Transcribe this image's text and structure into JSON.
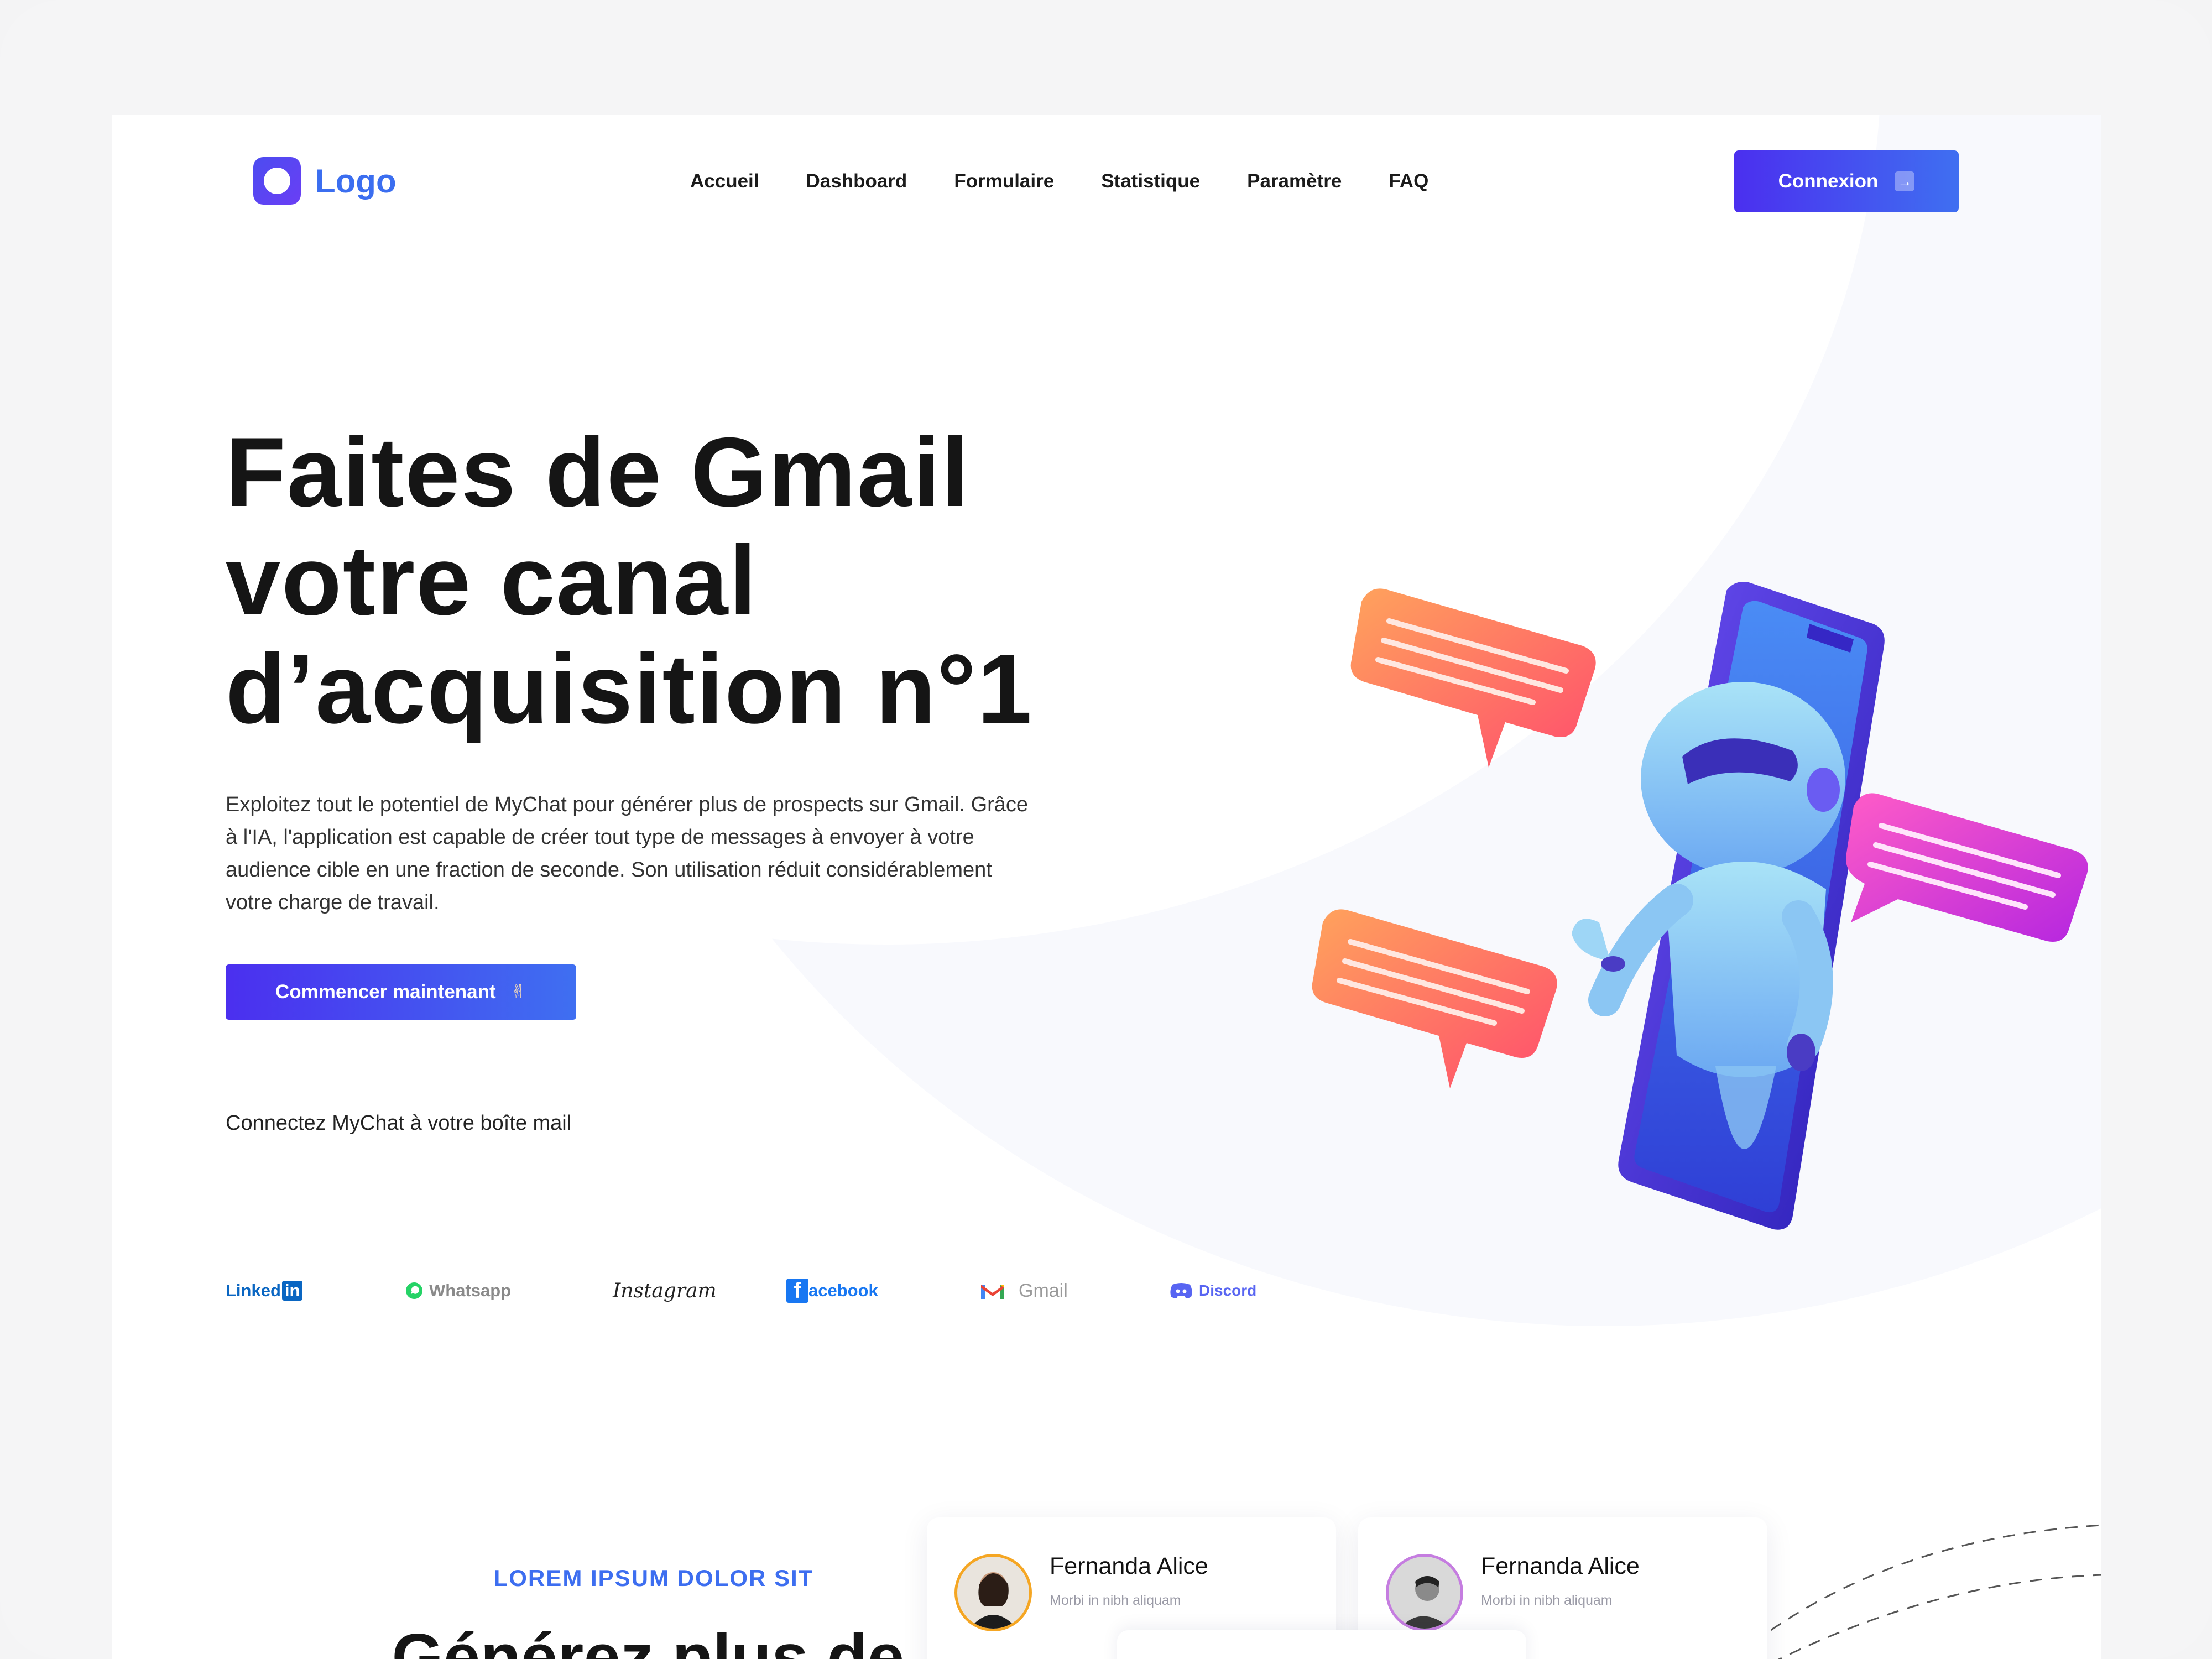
{
  "logo": {
    "text": "Logo"
  },
  "nav": {
    "items": [
      "Accueil",
      "Dashboard",
      "Formulaire",
      "Statistique",
      "Paramètre",
      "FAQ"
    ]
  },
  "login_button": {
    "label": "Connexion",
    "icon": "login-arrow-icon"
  },
  "hero": {
    "title_lines": [
      "Faites de Gmail",
      "votre canal",
      "d’acquisition n°1"
    ],
    "description": "Exploitez tout le potentiel de MyChat pour générer plus de prospects sur Gmail. Grâce à l'IA, l'application est capable de créer tout type de messages à envoyer à votre audience cible en une fraction de seconde. Son utilisation réduit considérablement votre charge de travail.",
    "cta_label": "Commencer maintenant",
    "cta_emoji": "✌",
    "connect_label": "Connectez MyChat à votre boîte mail"
  },
  "brands": [
    "Linked",
    "in",
    "Whatsapp",
    "Instagram",
    "acebook",
    "Gmail",
    "Discord"
  ],
  "section2": {
    "eyebrow": "LOREM IPSUM DOLOR SIT",
    "title": "Générez plus de"
  },
  "testimonials": [
    {
      "name": "Fernanda Alice",
      "subtitle": "Morbi in nibh aliquam"
    },
    {
      "name": "Fernanda Alice",
      "subtitle": "Morbi in nibh aliquam"
    }
  ],
  "colors": {
    "accent": "#3d6ef0",
    "button_gradient_start": "#4b2fef",
    "button_gradient_end": "#3f6ff1",
    "text_dark": "#151515"
  }
}
